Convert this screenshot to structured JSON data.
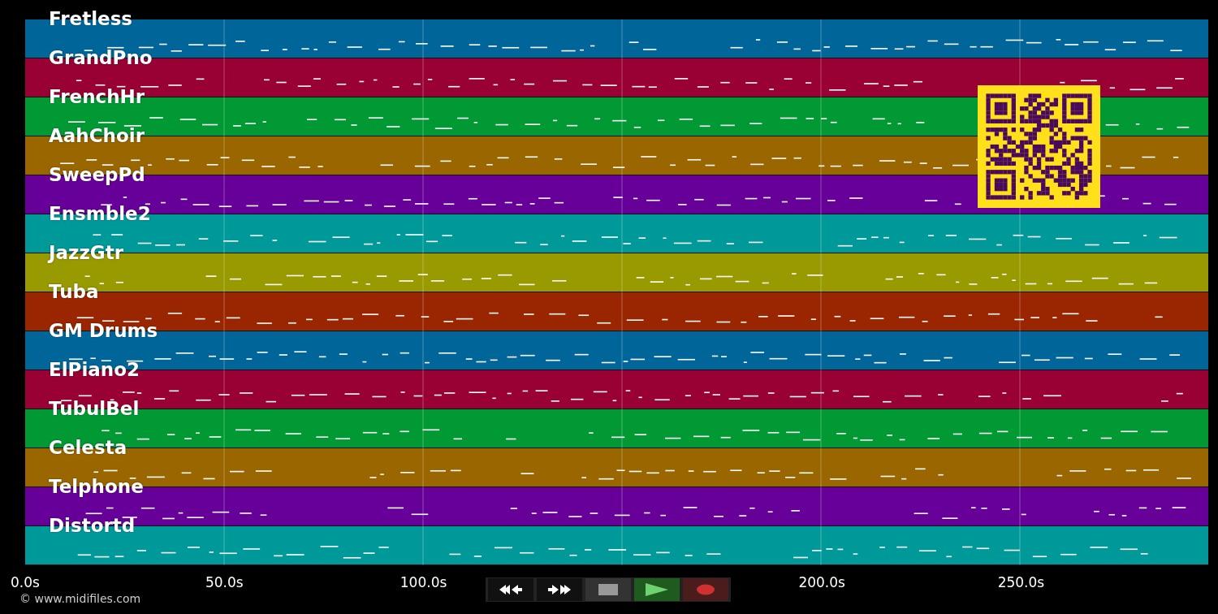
{
  "tracks": [
    {
      "name": "Fretless",
      "color": "#006699"
    },
    {
      "name": "GrandPno",
      "color": "#990033"
    },
    {
      "name": "FrenchHr",
      "color": "#009933"
    },
    {
      "name": "AahChoir",
      "color": "#996600"
    },
    {
      "name": "SweepPd",
      "color": "#660099"
    },
    {
      "name": "Ensmble2",
      "color": "#009999"
    },
    {
      "name": "JazzGtr",
      "color": "#999900"
    },
    {
      "name": "Tuba",
      "color": "#992600"
    },
    {
      "name": "GM Drums",
      "color": "#006699"
    },
    {
      "name": "ElPiano2",
      "color": "#990033"
    },
    {
      "name": "TubulBel",
      "color": "#009933"
    },
    {
      "name": "Celesta",
      "color": "#996600"
    },
    {
      "name": "Telphone",
      "color": "#660099"
    },
    {
      "name": "Distortd",
      "color": "#009999"
    }
  ],
  "time_axis": {
    "ticks": [
      "0.0s",
      "50.0s",
      "100.0s",
      "200.0s",
      "250.0s"
    ]
  },
  "transport": [
    {
      "kind": "rewind"
    },
    {
      "kind": "forward"
    },
    {
      "kind": "stop"
    },
    {
      "kind": "play"
    },
    {
      "kind": "record"
    }
  ],
  "copyright": "© www.midifiles.com"
}
